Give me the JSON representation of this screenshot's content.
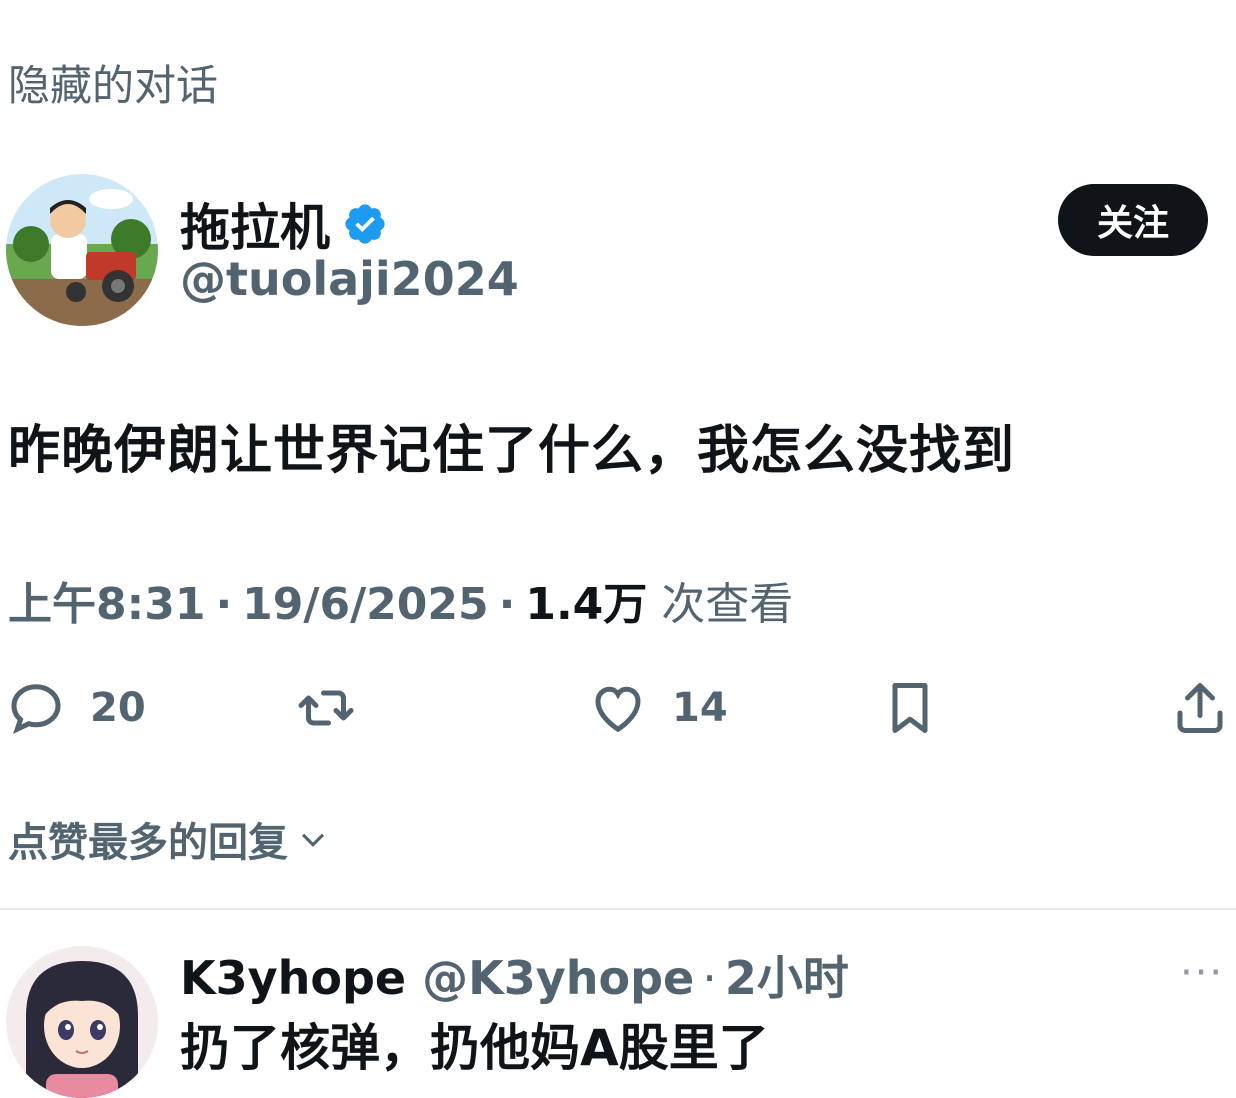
{
  "header": {
    "title": "隐藏的对话"
  },
  "tweet": {
    "author": {
      "display_name": "拖拉机",
      "handle": "@tuolaji2024",
      "avatar_icon": "cartoon-man-on-tractor-avatar",
      "verified_icon": "verified-badge-icon"
    },
    "follow_label": "关注",
    "text": "昨晚伊朗让世界记住了什么，我怎么没找到",
    "time": "上午8:31",
    "date": "19/6/2025",
    "views": "1.4万",
    "views_label": "次查看",
    "dot": "·",
    "actions": {
      "reply_count": "20",
      "like_count": "14"
    }
  },
  "replies_sort": {
    "label": "点赞最多的回复"
  },
  "reply": {
    "display_name": "K3yhope",
    "handle": "@K3yhope",
    "dot": "·",
    "time": "2小时",
    "more": "···",
    "text": "扔了核弹，扔他妈A股里了",
    "avatar_icon": "anime-girl-avatar"
  },
  "colors": {
    "primary_text": "#0f1419",
    "secondary_text": "#536471",
    "verified_blue": "#1d9bf0",
    "follow_bg": "#0f1419"
  }
}
